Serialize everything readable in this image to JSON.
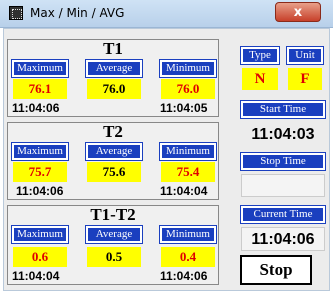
{
  "window": {
    "title": "Max / Min / AVG",
    "close_glyph": "x"
  },
  "labels": {
    "maximum": "Maximum",
    "average": "Average",
    "minimum": "Minimum"
  },
  "groups": [
    {
      "title": "T1",
      "max": "76.1",
      "avg": "76.0",
      "min": "76.0",
      "max_time": "11:04:06",
      "min_time": "11:04:05"
    },
    {
      "title": "T2",
      "max": "75.7",
      "avg": "75.6",
      "min": "75.4",
      "max_time": "11:04:06",
      "min_time": "11:04:04"
    },
    {
      "title": "T1-T2",
      "max": "0.6",
      "avg": "0.5",
      "min": "0.4",
      "max_time": "11:04:04",
      "min_time": "11:04:06"
    }
  ],
  "right": {
    "type_label": "Type",
    "type_value": "N",
    "unit_label": "Unit",
    "unit_value": "F",
    "start_label": "Start Time",
    "start_value": "11:04:03",
    "stop_label": "Stop Time",
    "stop_value": "",
    "current_label": "Current Time",
    "current_value": "11:04:06",
    "stop_button": "Stop"
  },
  "colors": {
    "label_bg": "#1a3fbf",
    "value_bg": "#ffff00",
    "alert_text": "#e00000"
  }
}
